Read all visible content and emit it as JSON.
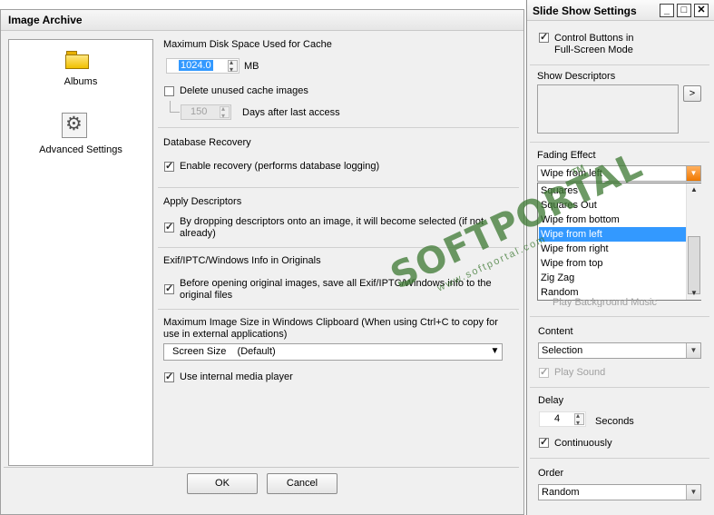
{
  "main": {
    "title": "Image Archive",
    "sidebar": [
      {
        "label": "Albums",
        "icon": "folder-icon"
      },
      {
        "label": "Advanced Settings",
        "icon": "gear-icon"
      }
    ],
    "cache": {
      "title": "Maximum Disk Space Used for Cache",
      "value": "1024.0",
      "unit": "MB",
      "delete_label": "Delete unused cache images",
      "delete_checked": false,
      "days_value": "150",
      "days_label": "Days after last access"
    },
    "db": {
      "title": "Database Recovery",
      "label": "Enable recovery (performs database logging)",
      "checked": true
    },
    "descriptors": {
      "title": "Apply Descriptors",
      "label": "By dropping descriptors onto an image, it will become selected (if not already)",
      "checked": true
    },
    "exif": {
      "title": "Exif/IPTC/Windows Info in Originals",
      "label": "Before opening original images, save all Exif/IPTC/Windows info to the original files",
      "checked": true
    },
    "clipboard": {
      "title": "Maximum Image Size in Windows Clipboard  (When using Ctrl+C to copy for use in external applications)",
      "selected": "Screen Size    (Default)"
    },
    "media": {
      "label": "Use internal media player",
      "checked": true
    },
    "ok_label": "OK",
    "cancel_label": "Cancel"
  },
  "slideshow": {
    "title": "Slide Show Settings",
    "control_buttons": {
      "label": "Control Buttons in Full-Screen Mode",
      "checked": true
    },
    "show_descriptors": {
      "title": "Show Descriptors",
      "button": ">"
    },
    "fading": {
      "title": "Fading Effect",
      "selected": "Wipe from left",
      "options": [
        "Squares",
        "Squares Out",
        "Wipe from bottom",
        "Wipe from left",
        "Wipe from right",
        "Wipe from top",
        "Zig Zag",
        "Random"
      ],
      "selected_index": 3
    },
    "background_music": {
      "label": "Play Background Music",
      "checked": false
    },
    "content": {
      "title": "Content",
      "selected": "Selection"
    },
    "play_sound": {
      "label": "Play Sound",
      "checked": true
    },
    "delay": {
      "title": "Delay",
      "value": "4",
      "unit": "Seconds"
    },
    "continuously": {
      "label": "Continuously",
      "checked": true
    },
    "order": {
      "title": "Order",
      "selected": "Random"
    }
  },
  "watermark": {
    "text": "SOFTPORTAL",
    "url": "www.softportal.com",
    "tm": "TM"
  },
  "colors": {
    "selection": "#3399ff",
    "watermark": "#3c7832"
  }
}
